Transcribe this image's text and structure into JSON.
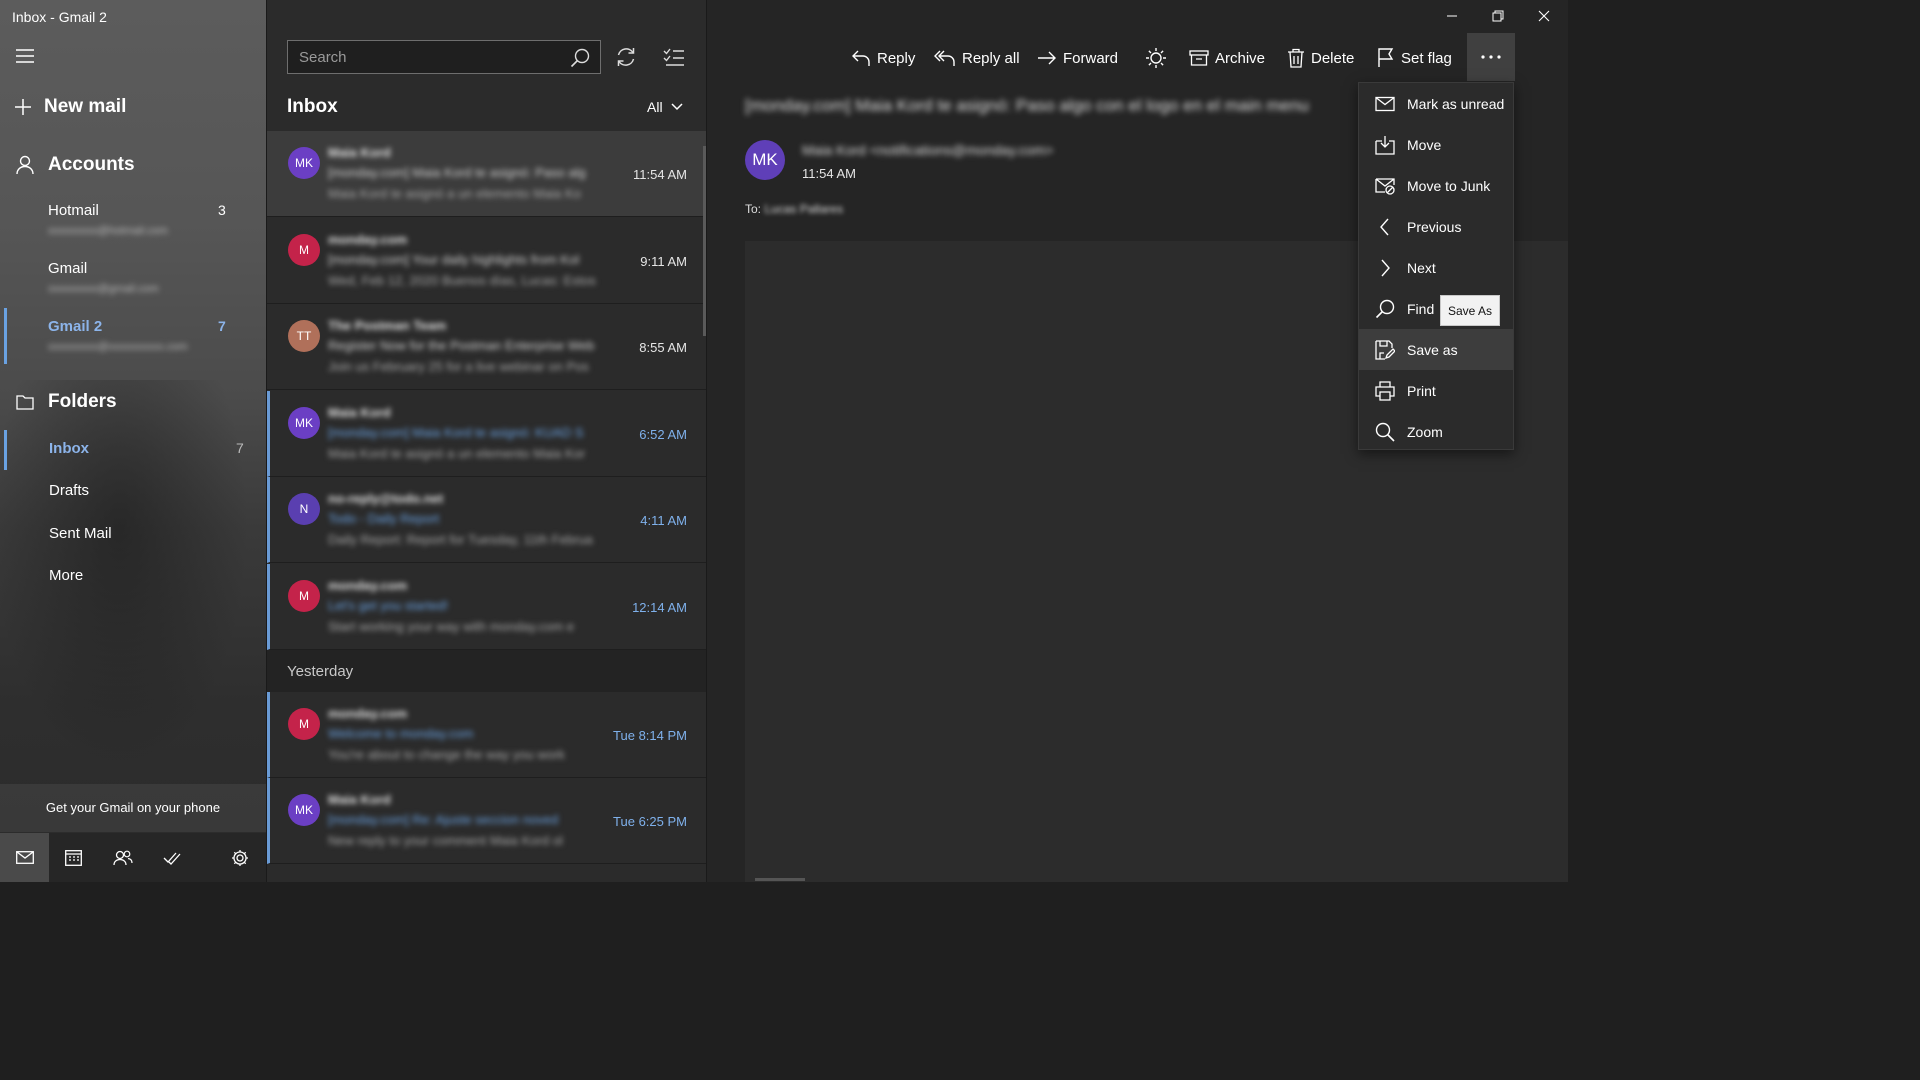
{
  "window": {
    "title": "Inbox - Gmail 2"
  },
  "sidebar": {
    "new_mail": "New mail",
    "accounts_heading": "Accounts",
    "accounts": [
      {
        "name": "Hotmail",
        "count": "3",
        "email": "xxxxxxxxx@hotmail.com"
      },
      {
        "name": "Gmail",
        "count": "",
        "email": "xxxxxxxxx@gmail.com"
      },
      {
        "name": "Gmail 2",
        "count": "7",
        "email": "xxxxxxxxx@xxxxxxxxxx.com"
      }
    ],
    "folders_heading": "Folders",
    "folders": [
      {
        "name": "Inbox",
        "count": "7"
      },
      {
        "name": "Drafts",
        "count": ""
      },
      {
        "name": "Sent Mail",
        "count": ""
      },
      {
        "name": "More",
        "count": ""
      }
    ],
    "promo": "Get your Gmail on your phone"
  },
  "list": {
    "search_placeholder": "Search",
    "title": "Inbox",
    "filter": "All",
    "items": [
      {
        "initials": "MK",
        "color": "#6b3fc4",
        "sender": "Maia Kord",
        "subject": "[monday.com] Maia Kord te asignó: Paso alg",
        "preview": "Maia Kord te asignó a un elemento Maia Ko",
        "time": "11:54 AM"
      },
      {
        "initials": "M",
        "color": "#c4234a",
        "sender": "monday.com",
        "subject": "[monday.com] Your daily highlights from Kol",
        "preview": "Wed, Feb 12, 2020 Buenos días, Lucas: Estos",
        "time": "9:11 AM"
      },
      {
        "initials": "TT",
        "color": "#b0705a",
        "sender": "The Postman Team",
        "subject": "Register Now for the Postman Enterprise Web",
        "preview": "Join us February 25 for a live webinar on Pos",
        "time": "8:55 AM"
      },
      {
        "initials": "MK",
        "color": "#6b3fc4",
        "sender": "Maia Kord",
        "subject": "[monday.com] Maia Kord te asignó: KUAD S",
        "preview": "Maia Kord te asignó a un elemento Maia Kor",
        "time": "6:52 AM"
      },
      {
        "initials": "N",
        "color": "#5a3fb0",
        "sender": "no-reply@todo.net",
        "subject": "Todo - Daily Report",
        "preview": "Daily Report: Report for Tuesday, 11th Februa",
        "time": "4:11 AM"
      },
      {
        "initials": "M",
        "color": "#c4234a",
        "sender": "monday.com",
        "subject": "Let's get you started!",
        "preview": "Start working your way with monday.com e",
        "time": "12:14 AM"
      }
    ],
    "group_label": "Yesterday",
    "items_yesterday": [
      {
        "initials": "M",
        "color": "#c4234a",
        "sender": "monday.com",
        "subject": "Welcome to monday.com",
        "preview": "You're about to change the way you work",
        "time": "Tue 8:14 PM"
      },
      {
        "initials": "MK",
        "color": "#6b3fc4",
        "sender": "Maia Kord",
        "subject": "[monday.com] Re: Ajuste seccion noved",
        "preview": "New reply to your comment Maia Kord ol",
        "time": "Tue 6:25 PM"
      }
    ]
  },
  "toolbar": {
    "reply": "Reply",
    "reply_all": "Reply all",
    "forward": "Forward",
    "archive": "Archive",
    "delete": "Delete",
    "set_flag": "Set flag"
  },
  "message": {
    "subject": "[monday.com] Maia Kord te asignó: Paso algo con el logo en el main menu",
    "initials": "MK",
    "from": "Maia Kord <notifications@monday.com>",
    "time": "11:54 AM",
    "to_label": "To:",
    "to_value": "Lucas Pallares"
  },
  "menu": {
    "items": [
      {
        "label": "Mark as unread",
        "icon": "envelope-icon"
      },
      {
        "label": "Move",
        "icon": "move-icon"
      },
      {
        "label": "Move to Junk",
        "icon": "junk-icon"
      },
      {
        "label": "Previous",
        "icon": "chevron-left-icon"
      },
      {
        "label": "Next",
        "icon": "chevron-right-icon"
      },
      {
        "label": "Find",
        "icon": "find-icon"
      },
      {
        "label": "Save as",
        "icon": "save-as-icon"
      },
      {
        "label": "Print",
        "icon": "print-icon"
      },
      {
        "label": "Zoom",
        "icon": "zoom-icon"
      }
    ],
    "tooltip": "Save As"
  },
  "colors": {
    "accent": "#6aa2e2",
    "unread_bar": "#6a9bd6"
  }
}
